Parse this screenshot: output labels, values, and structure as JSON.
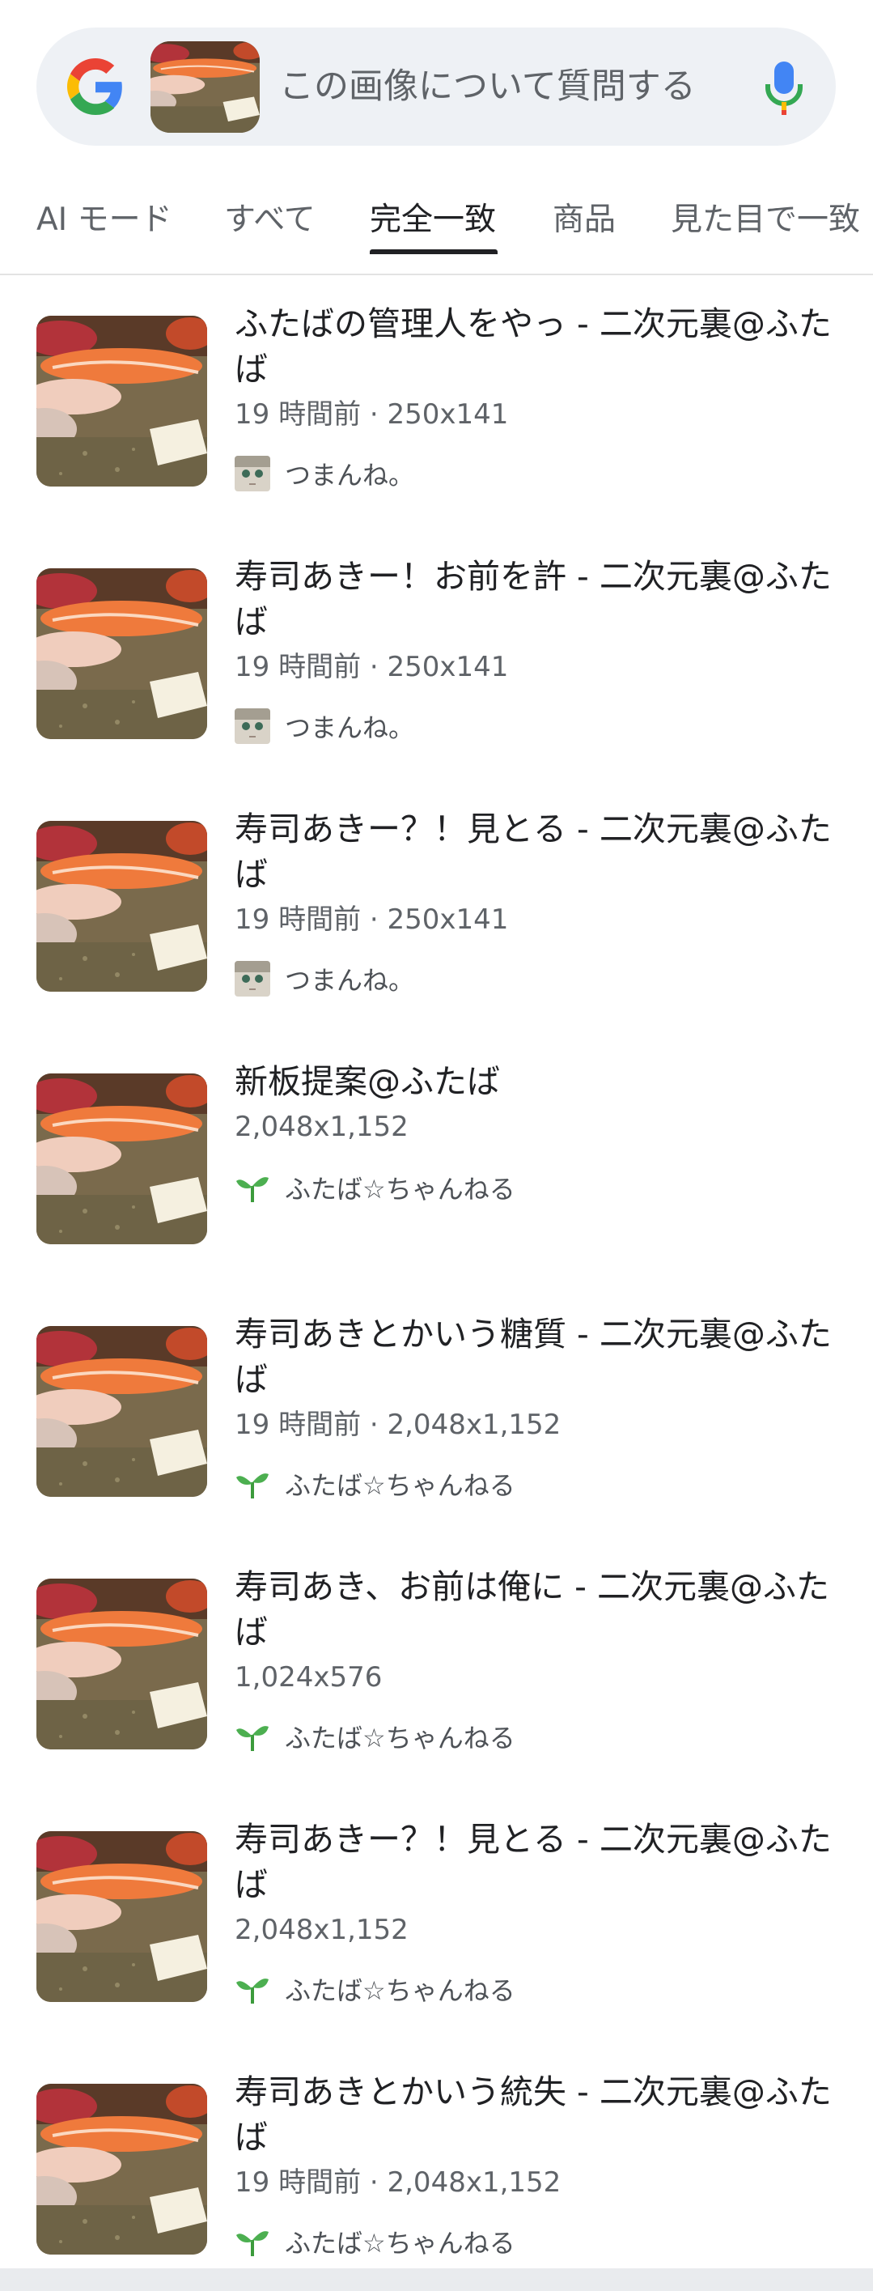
{
  "search": {
    "placeholder": "この画像について質問する",
    "logo": "google-g-icon",
    "mic_icon": "mic-icon"
  },
  "tabs": [
    {
      "label": "AI モード",
      "active": false
    },
    {
      "label": "すべて",
      "active": false
    },
    {
      "label": "完全一致",
      "active": true
    },
    {
      "label": "商品",
      "active": false
    },
    {
      "label": "見た目で一致",
      "active": false
    }
  ],
  "results": [
    {
      "title": "ふたばの管理人をやっ - 二次元裏@ふたば",
      "meta": "19 時間前 · 250x141",
      "source": "つまんね。",
      "source_icon": "anime-avatar-icon"
    },
    {
      "title": "寿司あきー！お前を許 - 二次元裏@ふたば",
      "meta": "19 時間前 · 250x141",
      "source": "つまんね。",
      "source_icon": "anime-avatar-icon"
    },
    {
      "title": "寿司あきー？！見とる - 二次元裏@ふたば",
      "meta": "19 時間前 · 250x141",
      "source": "つまんね。",
      "source_icon": "anime-avatar-icon"
    },
    {
      "title": "新板提案@ふたば",
      "meta": "2,048x1,152",
      "source": "ふたば☆ちゃんねる",
      "source_icon": "sprout-icon"
    },
    {
      "title": "寿司あきとかいう糖質 - 二次元裏@ふたば",
      "meta": "19 時間前 · 2,048x1,152",
      "source": "ふたば☆ちゃんねる",
      "source_icon": "sprout-icon"
    },
    {
      "title": "寿司あき、お前は俺に - 二次元裏@ふたば",
      "meta": "1,024x576",
      "source": "ふたば☆ちゃんねる",
      "source_icon": "sprout-icon"
    },
    {
      "title": "寿司あきー？！見とる - 二次元裏@ふたば",
      "meta": "2,048x1,152",
      "source": "ふたば☆ちゃんねる",
      "source_icon": "sprout-icon"
    },
    {
      "title": "寿司あきとかいう統失 - 二次元裏@ふたば",
      "meta": "19 時間前 · 2,048x1,152",
      "source": "ふたば☆ちゃんねる",
      "source_icon": "sprout-icon"
    }
  ],
  "colors": {
    "google_blue": "#4285F4",
    "google_red": "#EA4335",
    "google_yellow": "#FBBC05",
    "google_green": "#34A853",
    "sprout_green": "#4caf50"
  }
}
